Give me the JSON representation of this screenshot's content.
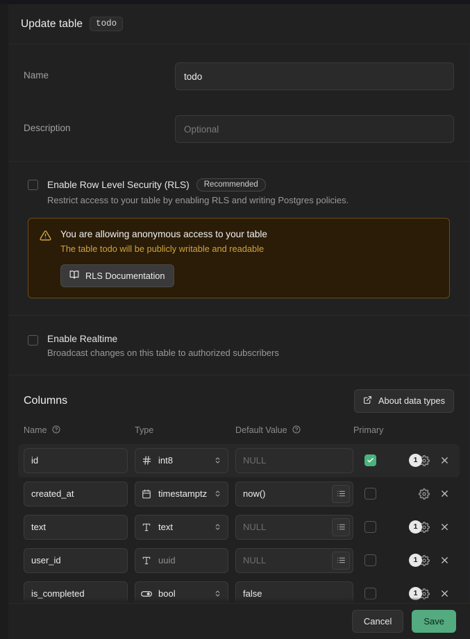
{
  "header": {
    "title": "Update table",
    "table_chip": "todo"
  },
  "form": {
    "name_label": "Name",
    "name_value": "todo",
    "description_label": "Description",
    "description_placeholder": "Optional",
    "rls": {
      "title": "Enable Row Level Security (RLS)",
      "badge": "Recommended",
      "description": "Restrict access to your table by enabling RLS and writing Postgres policies.",
      "checked": false
    },
    "warning": {
      "icon": "warning-triangle-icon",
      "title": "You are allowing anonymous access to your table",
      "subtitle": "The table todo will be publicly writable and readable",
      "button_label": "RLS Documentation",
      "button_icon": "book-icon",
      "border_color": "#6b4d16",
      "background_color": "#2a1c06",
      "accent_color": "#d2a340"
    },
    "realtime": {
      "title": "Enable Realtime",
      "description": "Broadcast changes on this table to authorized subscribers",
      "checked": false
    }
  },
  "columns": {
    "title": "Columns",
    "about_button": "About data types",
    "about_icon": "external-link-icon",
    "headers": {
      "name": "Name",
      "type": "Type",
      "default_value": "Default Value",
      "primary": "Primary"
    },
    "rows": [
      {
        "name": "id",
        "type": "int8",
        "type_icon": "hash-icon",
        "type_muted": false,
        "has_type_stepper": true,
        "default_value": "NULL",
        "default_is_placeholder": true,
        "has_list_button": false,
        "primary": true,
        "badge_count": "1",
        "selected": true
      },
      {
        "name": "created_at",
        "type": "timestamptz",
        "type_icon": "calendar-icon",
        "type_muted": false,
        "has_type_stepper": true,
        "default_value": "now()",
        "default_is_placeholder": false,
        "has_list_button": true,
        "primary": false,
        "badge_count": "",
        "selected": false
      },
      {
        "name": "text",
        "type": "text",
        "type_icon": "text-icon",
        "type_muted": false,
        "has_type_stepper": true,
        "default_value": "NULL",
        "default_is_placeholder": true,
        "has_list_button": true,
        "primary": false,
        "badge_count": "1",
        "selected": false
      },
      {
        "name": "user_id",
        "type": "uuid",
        "type_icon": "text-icon",
        "type_muted": true,
        "has_type_stepper": false,
        "default_value": "NULL",
        "default_is_placeholder": true,
        "has_list_button": true,
        "primary": false,
        "badge_count": "1",
        "selected": false
      },
      {
        "name": "is_completed",
        "type": "bool",
        "type_icon": "toggle-icon",
        "type_muted": false,
        "has_type_stepper": true,
        "default_value": "false",
        "default_is_placeholder": false,
        "has_list_button": false,
        "primary": false,
        "badge_count": "1",
        "selected": false
      }
    ]
  },
  "footer": {
    "cancel_label": "Cancel",
    "save_label": "Save",
    "save_color": "#53ab7f"
  },
  "scrollbar": {
    "up_arrow": "chevron-up-icon",
    "down_arrow": "chevron-down-icon"
  }
}
